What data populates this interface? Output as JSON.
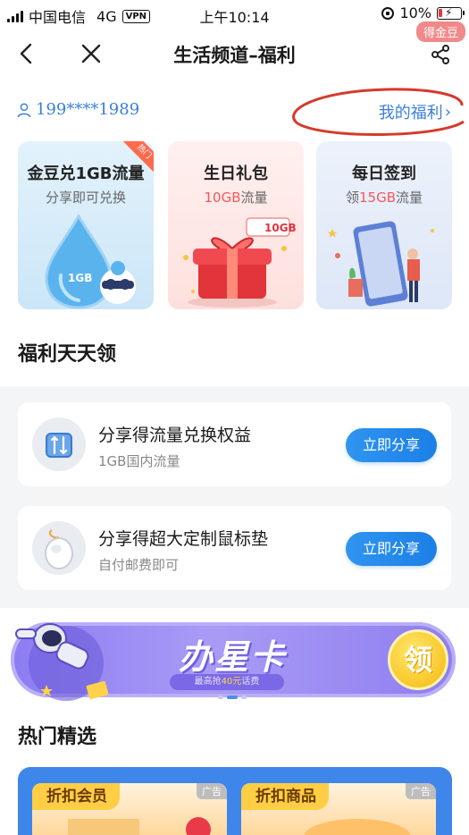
{
  "status_bar": {
    "carrier": "中国电信",
    "network": "4G",
    "vpn": "VPN",
    "time": "上午10:14",
    "battery": "10%"
  },
  "nav": {
    "title": "生活频道–福利",
    "badge": "得金豆"
  },
  "user": {
    "phone": "199****1989",
    "my_welfare": "我的福利",
    "chevron": "›"
  },
  "cards": [
    {
      "title": "金豆兑1GB流量",
      "sub": "分享即可兑换",
      "tag": "热门",
      "art_label": "1GB"
    },
    {
      "title": "生日礼包",
      "sub_highlight": "10GB",
      "sub_rest": "流量",
      "art_label": "10GB"
    },
    {
      "title": "每日签到",
      "sub_prefix": "领",
      "sub_highlight": "15GB",
      "sub_rest": "流量"
    }
  ],
  "section_daily": "福利天天领",
  "list_items": [
    {
      "title": "分享得流量兑换权益",
      "sub": "1GB国内流量",
      "button": "立即分享",
      "icon": "data-transfer-icon"
    },
    {
      "title": "分享得超大定制鼠标垫",
      "sub": "自付邮费即可",
      "button": "立即分享",
      "icon": "mouse-icon"
    }
  ],
  "banner": {
    "title": "办星卡",
    "sub_prefix": "最高抢",
    "sub_amount": "40元",
    "sub_suffix": "话费",
    "button": "领"
  },
  "section_hot": "热门精选",
  "featured": [
    {
      "tag": "折扣会员",
      "ad": "广告"
    },
    {
      "tag": "折扣商品",
      "ad": "广告"
    }
  ],
  "colors": {
    "accent_blue": "#3b7fd9",
    "button_blue": "#1c7fe6",
    "highlight_red": "#f25a5a",
    "banner_purple": "#8b7cf2",
    "badge_pink": "#f08a8a"
  }
}
